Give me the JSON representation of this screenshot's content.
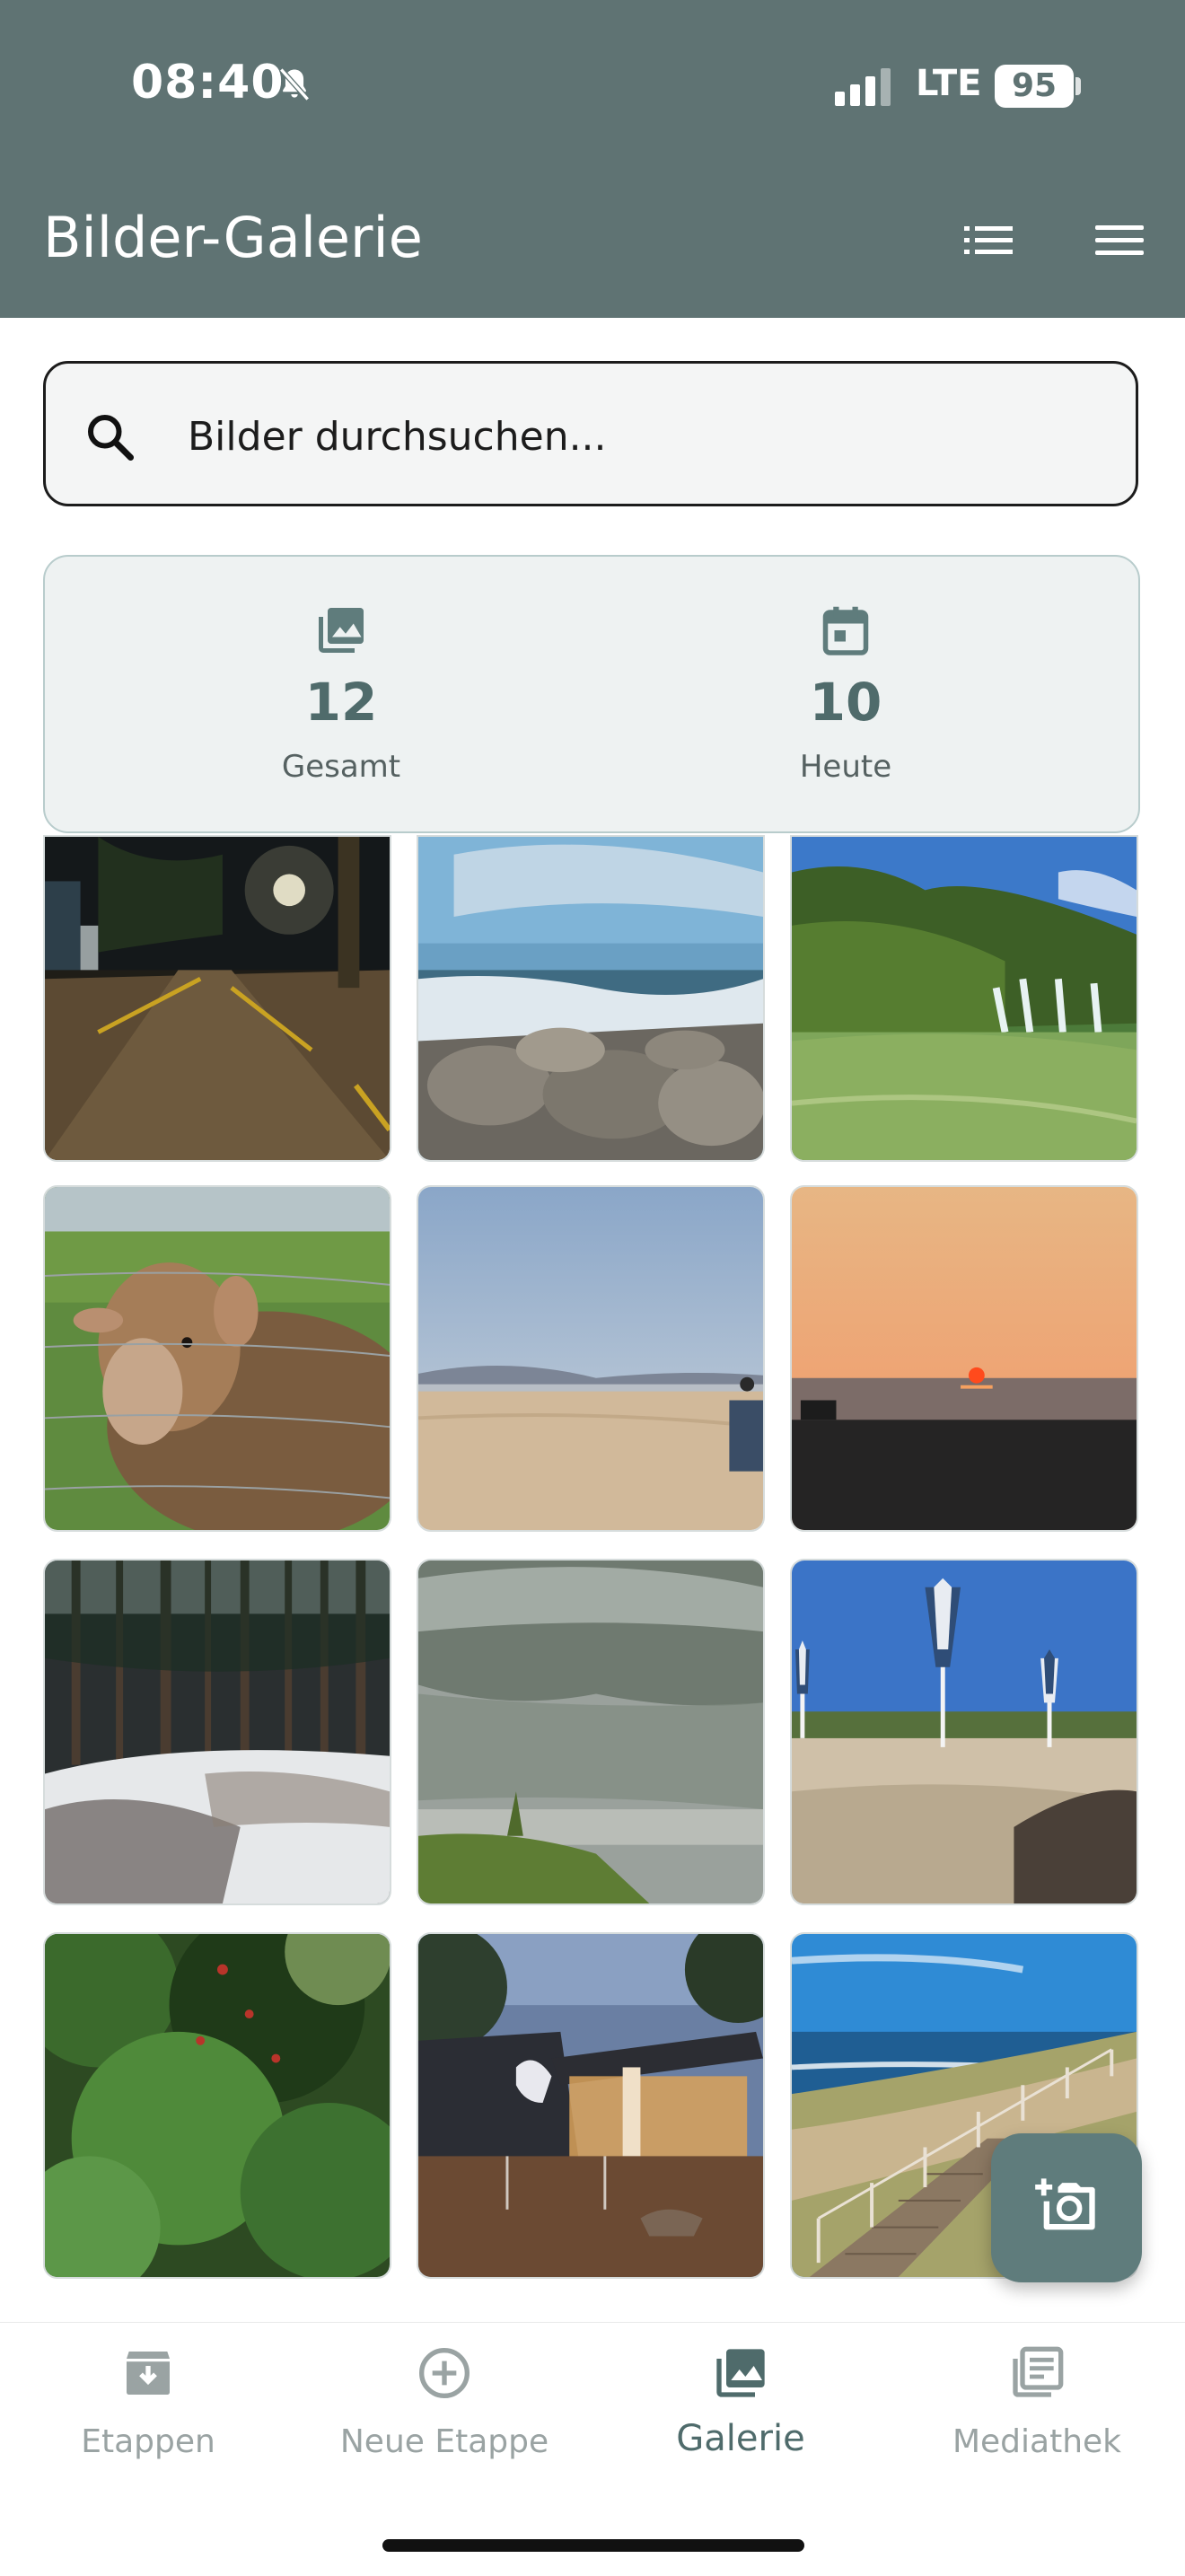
{
  "status_bar": {
    "time": "08:40",
    "network": "LTE",
    "battery": "95"
  },
  "header": {
    "title": "Bilder-Galerie",
    "icons": [
      "list-view-icon",
      "menu-icon"
    ]
  },
  "search": {
    "placeholder": "Bilder durchsuchen..."
  },
  "stats": {
    "total": {
      "value": "12",
      "label": "Gesamt",
      "icon": "photo-library-icon"
    },
    "today": {
      "value": "10",
      "label": "Heute",
      "icon": "calendar-icon"
    }
  },
  "gallery": {
    "images": [
      "night-road-photo",
      "rocky-shore-waves-photo",
      "waterfall-lake-photo",
      "sheep-fence-photo",
      "sandy-beach-dusk-photo",
      "sunset-sea-photo",
      "snowy-forest-photo",
      "misty-lake-photo",
      "beach-umbrellas-photo",
      "green-bushes-photo",
      "campsite-evening-photo",
      "coastal-boardwalk-photo"
    ]
  },
  "fab": {
    "icon": "add-photo-icon"
  },
  "bottom_nav": {
    "items": [
      {
        "label": "Etappen",
        "icon": "archive-icon",
        "active": false
      },
      {
        "label": "Neue Etappe",
        "icon": "add-circle-icon",
        "active": false
      },
      {
        "label": "Galerie",
        "icon": "photo-library-icon",
        "active": true
      },
      {
        "label": "Mediathek",
        "icon": "library-books-icon",
        "active": false
      }
    ]
  },
  "colors": {
    "header": "#5f7373",
    "accent": "#4f6b6b",
    "fab": "#5f7c7c",
    "inactive": "#9aa3a3"
  }
}
